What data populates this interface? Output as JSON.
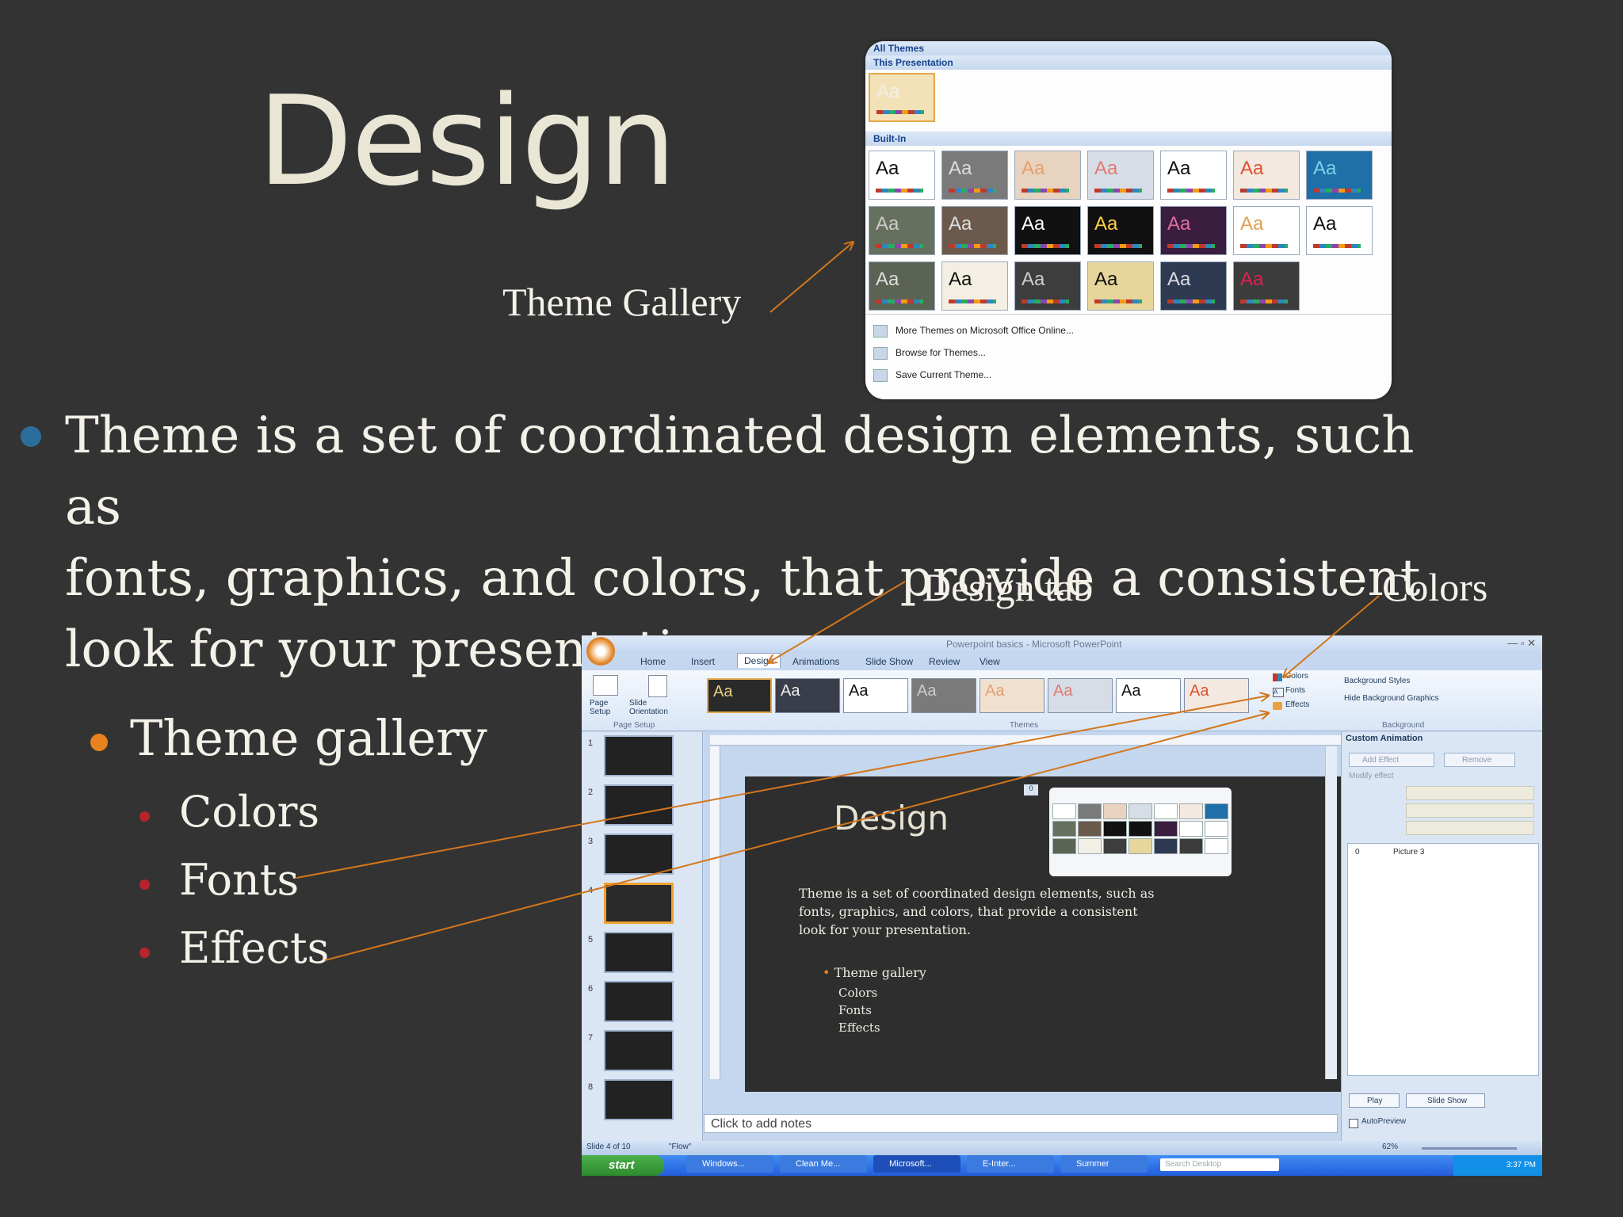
{
  "slide": {
    "title": "Design",
    "callouts": {
      "theme_gallery": "Theme Gallery",
      "design_tab": "Design tab",
      "colors": "Colors"
    },
    "bullet_main": "Theme is a set of coordinated design elements, such as fonts, graphics, and colors, that provide a consistent look for your presentation.",
    "bullet_main_lines": [
      "Theme is a set of coordinated design elements, such as",
      "fonts, graphics, and colors, that provide a consistent",
      "look for your presentation."
    ],
    "sub_bullet": "Theme gallery",
    "sub_sub_bullets": [
      "Colors",
      "Fonts",
      "Effects"
    ],
    "colors": {
      "background": "#333333",
      "bullet1": "#2c6e9b",
      "bullet2": "#e8821e",
      "bullet3": "#b8242c",
      "arrow": "#d4761c"
    }
  },
  "gallery": {
    "all_themes": "All Themes",
    "this_presentation": "This Presentation",
    "built_in": "Built-In",
    "tile_label": "Aa",
    "menu": [
      "More Themes on Microsoft Office Online...",
      "Browse for Themes...",
      "Save Current Theme..."
    ]
  },
  "ppt": {
    "window_title": "Powerpoint basics - Microsoft PowerPoint",
    "tabs": [
      "Home",
      "Insert",
      "Design",
      "Animations",
      "Slide Show",
      "Review",
      "View"
    ],
    "page_setup": [
      "Page Setup",
      "Slide Orientation"
    ],
    "group_labels": [
      "Page Setup",
      "Themes",
      "Background"
    ],
    "theme_buttons": [
      "Colors",
      "Fonts",
      "Effects"
    ],
    "background_buttons": [
      "Background Styles",
      "Hide Background Graphics"
    ],
    "custom_animation": "Custom Animation",
    "add_effect": "Add Effect",
    "remove": "Remove",
    "modify_effect": "Modify effect",
    "anim_item": "Picture 3",
    "play": "Play",
    "slide_show": "Slide Show",
    "autopreview": "AutoPreview",
    "notes": "Click to add notes",
    "status": "Slide 4 of 10",
    "status_theme": "\"Flow\"",
    "zoom": "62%",
    "slide_title": "Design",
    "slide_body": [
      "Theme is a set of coordinated design elements, such as",
      "fonts, graphics, and colors, that provide a consistent",
      "look for your presentation."
    ],
    "slide_sub": "Theme gallery",
    "slide_subsub": [
      "Colors",
      "Fonts",
      "Effects"
    ],
    "taskbar": {
      "start": "start",
      "items": [
        "Windows...",
        "Clean Me...",
        "Microsoft...",
        "E-Inter...",
        "Summer"
      ],
      "search": "Search Desktop",
      "time": "3:37 PM"
    }
  }
}
